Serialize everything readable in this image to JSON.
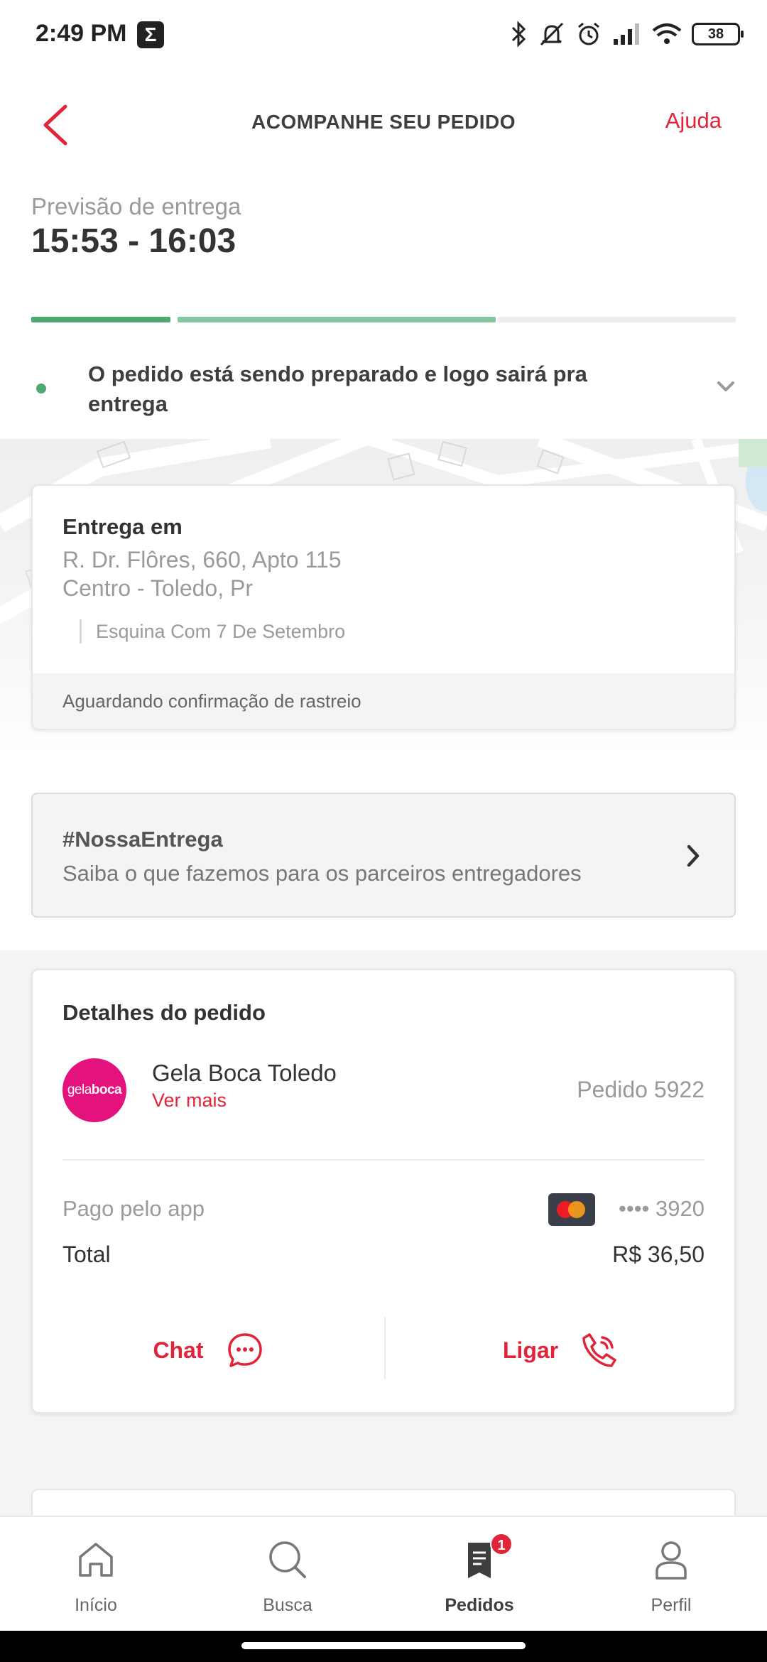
{
  "status_bar": {
    "time": "2:49 PM",
    "app_icon_letter": "Σ",
    "battery": "38",
    "icons": [
      "bluetooth-icon",
      "mute-icon",
      "alarm-icon",
      "signal-icon",
      "wifi-icon",
      "battery-icon"
    ]
  },
  "header": {
    "title": "ACOMPANHE SEU PEDIDO",
    "help_label": "Ajuda",
    "back_icon": "chevron-left-icon"
  },
  "delivery": {
    "forecast_label": "Previsão de entrega",
    "forecast_time": "15:53 - 16:03",
    "status_message": "O pedido está sendo preparado e logo sairá pra entrega",
    "colors": {
      "progress_done": "#50a773",
      "progress_active": "#86c5a0",
      "progress_pending": "#ececec"
    }
  },
  "address": {
    "title": "Entrega em",
    "line1": "R. Dr. Flôres, 660,  Apto 115",
    "line2": "Centro - Toledo, Pr",
    "reference": "Esquina Com 7 De Setembro",
    "tracking_status": "Aguardando confirmação de rastreio"
  },
  "partner_banner": {
    "title": "#NossaEntrega",
    "subtitle": "Saiba o que fazemos para os parceiros entregadores"
  },
  "order": {
    "title": "Detalhes do pedido",
    "store_logo_text_light": "gela",
    "store_logo_text_bold": "boca",
    "store_name": "Gela Boca Toledo",
    "store_more": "Ver mais",
    "order_number": "Pedido 5922",
    "payment_label": "Pago pelo app",
    "card_masked": "•••• 3920",
    "total_label": "Total",
    "total_value": "R$ 36,50",
    "chat_label": "Chat",
    "call_label": "Ligar",
    "colors": {
      "accent": "#e0253a",
      "store_brand": "#e4127d"
    }
  },
  "bottom_nav": {
    "items": [
      {
        "label": "Início",
        "icon": "home-icon"
      },
      {
        "label": "Busca",
        "icon": "search-icon"
      },
      {
        "label": "Pedidos",
        "icon": "orders-icon",
        "badge": "1",
        "active": true
      },
      {
        "label": "Perfil",
        "icon": "profile-icon"
      }
    ]
  }
}
